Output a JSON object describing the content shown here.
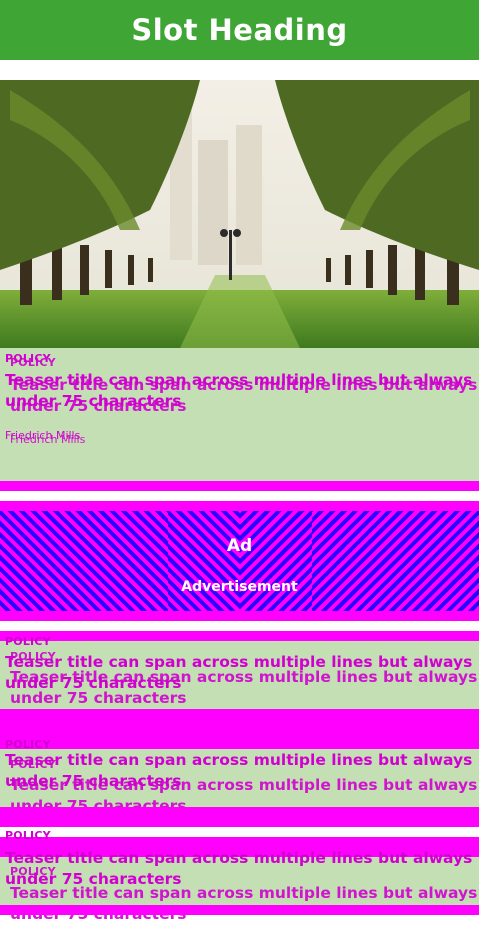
{
  "slot": {
    "heading": "Slot Heading"
  },
  "card1": {
    "category": "POLICY",
    "title": "Teaser title can span across multiple lines but always under 75 characters",
    "author": "Friedrich Mills"
  },
  "ad": {
    "label": "Ad",
    "sublabel": "Advertisement"
  },
  "card2": {
    "category": "POLICY",
    "title": "Teaser title can span across multiple lines but always under 75 characters"
  },
  "card3": {
    "category": "POLICY",
    "title": "Teaser title can span across multiple lines but always under 75 characters"
  },
  "card4": {
    "category": "POLICY",
    "title": "Teaser title can span across multiple lines but always under 75 characters"
  },
  "colors": {
    "heading_bar": "#3fa535",
    "card_bg": "#c3dfb3",
    "debug_magenta": "#ff00ff",
    "debug_blue": "#2a00ff"
  }
}
